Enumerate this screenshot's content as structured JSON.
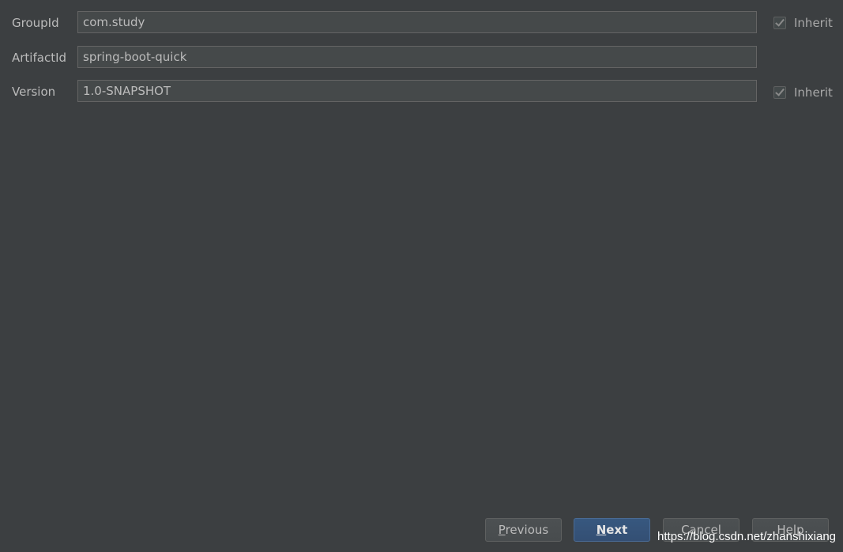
{
  "form": {
    "group_id": {
      "label": "GroupId",
      "value": "com.study",
      "inherit": {
        "label": "Inherit",
        "checked": true
      }
    },
    "artifact_id": {
      "label": "ArtifactId",
      "value": "spring-boot-quick"
    },
    "version": {
      "label": "Version",
      "value": "1.0-SNAPSHOT",
      "inherit": {
        "label": "Inherit",
        "checked": true
      }
    }
  },
  "buttons": {
    "previous": {
      "mnemonic": "P",
      "rest": "revious"
    },
    "next": {
      "mnemonic": "N",
      "rest": "ext"
    },
    "cancel": "Cancel",
    "help": "Help"
  },
  "watermark": "https://blog.csdn.net/zhanshixiang",
  "colors": {
    "background": "#3c3f41",
    "field_background": "#45494a",
    "field_border": "#646464",
    "text": "#bbbbbb",
    "primary_button": "#365880"
  }
}
